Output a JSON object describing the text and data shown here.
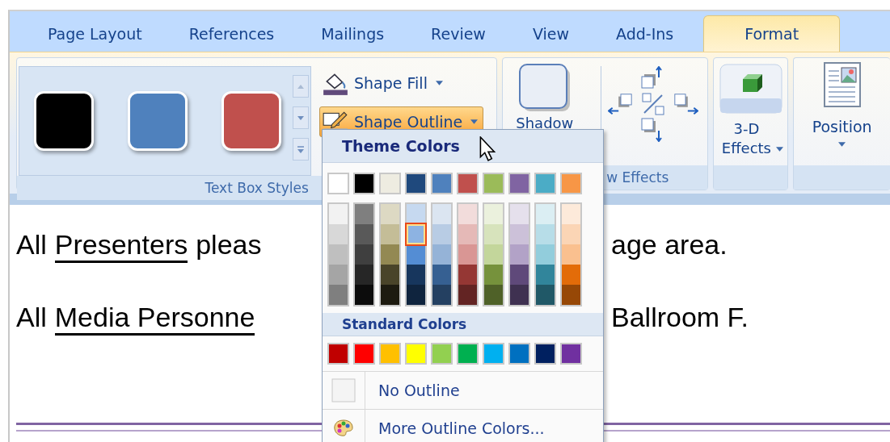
{
  "tabs": [
    {
      "label": "Page Layout",
      "selected": false
    },
    {
      "label": "References",
      "selected": false
    },
    {
      "label": "Mailings",
      "selected": false
    },
    {
      "label": "Review",
      "selected": false
    },
    {
      "label": "View",
      "selected": false
    },
    {
      "label": "Add-Ins",
      "selected": false
    },
    {
      "label": "Format",
      "selected": true
    }
  ],
  "text_box_styles": {
    "styles": [
      {
        "color": "#000000"
      },
      {
        "color": "#4f81bd"
      },
      {
        "color": "#c0504d"
      }
    ],
    "shape_fill": {
      "label": "Shape Fill",
      "pressed": false
    },
    "shape_outline": {
      "label": "Shape Outline",
      "pressed": true
    },
    "group_label": "Text Box Styles"
  },
  "shadow_effects": {
    "shadow_label": "Shadow",
    "group_label": "w Effects"
  },
  "three_d": {
    "label": "3-D Effects"
  },
  "arrange": {
    "position_label": "Position"
  },
  "document": {
    "lines": [
      {
        "left": [
          {
            "text": "All",
            "underlined": false
          },
          {
            "text": "Presenters",
            "underlined": true
          },
          {
            "text": "pleas",
            "underlined": false
          }
        ],
        "right": "age area."
      },
      {
        "left": [
          {
            "text": "All",
            "underlined": false
          },
          {
            "text": "Media Personne",
            "underlined": true
          }
        ],
        "right": "Ballroom F."
      }
    ]
  },
  "menu": {
    "theme_title": "Theme Colors",
    "theme_swatches": [
      {
        "color": "#ffffff"
      },
      {
        "color": "#000000"
      },
      {
        "color": "#eeece1"
      },
      {
        "color": "#1f497d"
      },
      {
        "color": "#4f81bd"
      },
      {
        "color": "#c0504d"
      },
      {
        "color": "#9bbb59"
      },
      {
        "color": "#8064a2"
      },
      {
        "color": "#4bacc6"
      },
      {
        "color": "#f79646"
      }
    ],
    "shades": [
      {
        "swatches": [
          {
            "color": "#f2f2f2",
            "selected": false
          },
          {
            "color": "#d8d8d8",
            "selected": false
          },
          {
            "color": "#bfbfbf",
            "selected": false
          },
          {
            "color": "#a5a5a5",
            "selected": false
          },
          {
            "color": "#7f7f7f",
            "selected": false
          }
        ]
      },
      {
        "swatches": [
          {
            "color": "#7f7f7f",
            "selected": false
          },
          {
            "color": "#595959",
            "selected": false
          },
          {
            "color": "#3f3f3f",
            "selected": false
          },
          {
            "color": "#262626",
            "selected": false
          },
          {
            "color": "#0c0c0c",
            "selected": false
          }
        ]
      },
      {
        "swatches": [
          {
            "color": "#ddd9c3",
            "selected": false
          },
          {
            "color": "#c4bd97",
            "selected": false
          },
          {
            "color": "#938953",
            "selected": false
          },
          {
            "color": "#494429",
            "selected": false
          },
          {
            "color": "#1d1b10",
            "selected": false
          }
        ]
      },
      {
        "swatches": [
          {
            "color": "#c6d9f0",
            "selected": false
          },
          {
            "color": "#8db3e2",
            "selected": true
          },
          {
            "color": "#548dd4",
            "selected": false
          },
          {
            "color": "#17365d",
            "selected": false
          },
          {
            "color": "#0f243e",
            "selected": false
          }
        ]
      },
      {
        "swatches": [
          {
            "color": "#dbe5f1",
            "selected": false
          },
          {
            "color": "#b8cce4",
            "selected": false
          },
          {
            "color": "#95b3d7",
            "selected": false
          },
          {
            "color": "#366092",
            "selected": false
          },
          {
            "color": "#244061",
            "selected": false
          }
        ]
      },
      {
        "swatches": [
          {
            "color": "#f2dcdb",
            "selected": false
          },
          {
            "color": "#e5b9b7",
            "selected": false
          },
          {
            "color": "#d99694",
            "selected": false
          },
          {
            "color": "#953734",
            "selected": false
          },
          {
            "color": "#632423",
            "selected": false
          }
        ]
      },
      {
        "swatches": [
          {
            "color": "#ebf1dd",
            "selected": false
          },
          {
            "color": "#d7e3bc",
            "selected": false
          },
          {
            "color": "#c3d69b",
            "selected": false
          },
          {
            "color": "#76923c",
            "selected": false
          },
          {
            "color": "#4f6128",
            "selected": false
          }
        ]
      },
      {
        "swatches": [
          {
            "color": "#e5e0ec",
            "selected": false
          },
          {
            "color": "#ccc1d9",
            "selected": false
          },
          {
            "color": "#b2a2c7",
            "selected": false
          },
          {
            "color": "#5f497a",
            "selected": false
          },
          {
            "color": "#3f3151",
            "selected": false
          }
        ]
      },
      {
        "swatches": [
          {
            "color": "#dbeef3",
            "selected": false
          },
          {
            "color": "#b7dde8",
            "selected": false
          },
          {
            "color": "#92cddc",
            "selected": false
          },
          {
            "color": "#31859b",
            "selected": false
          },
          {
            "color": "#205867",
            "selected": false
          }
        ]
      },
      {
        "swatches": [
          {
            "color": "#fdeada",
            "selected": false
          },
          {
            "color": "#fbd5b5",
            "selected": false
          },
          {
            "color": "#fac08f",
            "selected": false
          },
          {
            "color": "#e36c09",
            "selected": false
          },
          {
            "color": "#974806",
            "selected": false
          }
        ]
      }
    ],
    "standard_title": "Standard Colors",
    "standard_swatches": [
      {
        "color": "#c00000"
      },
      {
        "color": "#ff0000"
      },
      {
        "color": "#ffc000"
      },
      {
        "color": "#ffff00"
      },
      {
        "color": "#92d050"
      },
      {
        "color": "#00b050"
      },
      {
        "color": "#00b0f0"
      },
      {
        "color": "#0070c0"
      },
      {
        "color": "#002060"
      },
      {
        "color": "#7030a0"
      }
    ],
    "items": [
      {
        "kind": "none",
        "label": "No Outline"
      },
      {
        "kind": "more",
        "label": "More Outline Colors..."
      }
    ]
  }
}
